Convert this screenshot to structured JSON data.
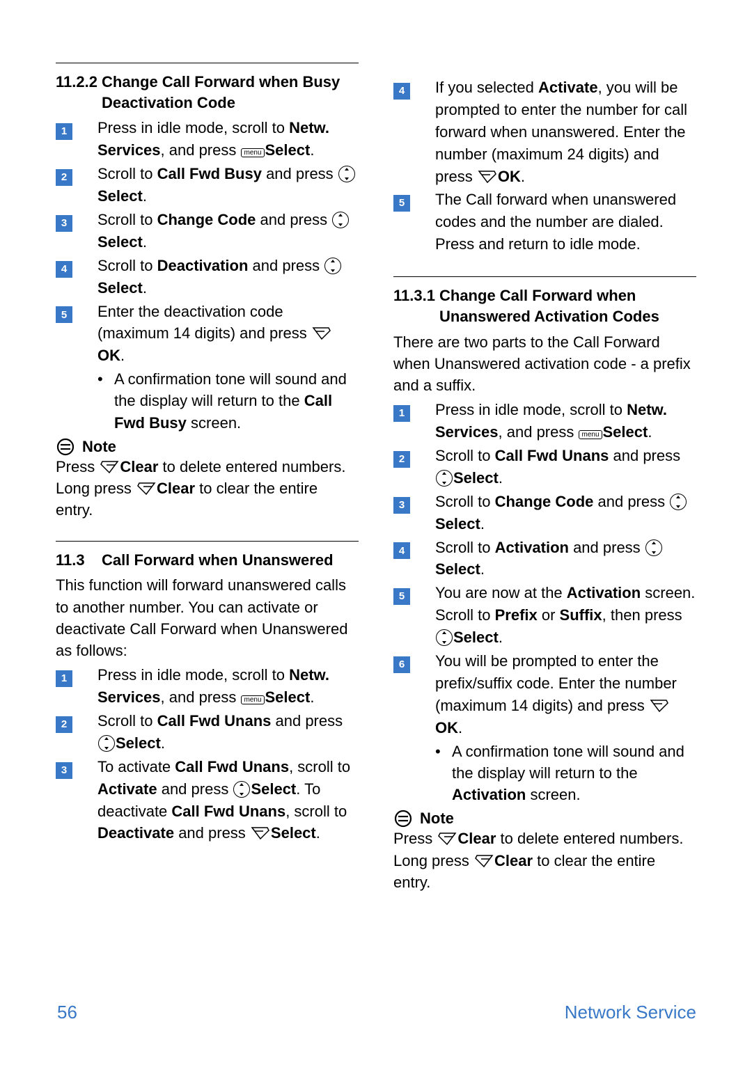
{
  "left": {
    "h1122_num": "11.2.2",
    "h1122_title": "Change Call Forward when Busy Deactivation Code",
    "steps_1122": [
      {
        "n": "1",
        "parts": [
          "Press ",
          " in idle mode, scroll ",
          " to ",
          {
            "b": "Netw. Services"
          },
          ", and press ",
          " ",
          {
            "b": "Select"
          },
          "."
        ]
      },
      {
        "n": "2",
        "parts": [
          "Scroll ",
          " to ",
          {
            "b": "Call Fwd Busy"
          },
          " and press ",
          " ",
          {
            "b": "Select"
          },
          "."
        ]
      },
      {
        "n": "3",
        "parts": [
          "Scroll ",
          " to ",
          {
            "b": "Change Code"
          },
          " and press ",
          " ",
          {
            "b": "Select"
          },
          "."
        ]
      },
      {
        "n": "4",
        "parts": [
          "Scroll ",
          " to ",
          {
            "b": "Deactivation"
          },
          " and press ",
          " ",
          {
            "b": "Select"
          },
          "."
        ]
      },
      {
        "n": "5",
        "parts": [
          "Enter the deactivation code (maximum 14 digits) and press ",
          " ",
          {
            "b": "OK"
          },
          "."
        ]
      }
    ],
    "sub_1122": [
      "A confirmation tone will sound and the display will return to the ",
      {
        "b": "Call Fwd Busy"
      },
      " screen."
    ],
    "note_label": "Note",
    "note_body_parts": [
      "Press ",
      " ",
      {
        "b": "Clear"
      },
      " to delete entered numbers. Long press ",
      " ",
      {
        "b": "Clear"
      },
      " to clear the entire entry."
    ],
    "h113_num": "11.3",
    "h113_title": "Call Forward when Unanswered",
    "p113": "This function will forward unanswered calls to another number. You can activate or deactivate Call Forward when Unanswered as follows:",
    "steps_113": [
      {
        "n": "1",
        "parts": [
          "Press ",
          " in idle mode, scroll ",
          " to ",
          {
            "b": "Netw. Services"
          },
          ", and press ",
          " ",
          {
            "b": "Select"
          },
          "."
        ]
      },
      {
        "n": "2",
        "parts": [
          "Scroll ",
          " to ",
          {
            "b": "Call Fwd Unans"
          },
          " and press ",
          " ",
          {
            "b": "Select"
          },
          "."
        ]
      },
      {
        "n": "3",
        "parts": [
          "To activate ",
          {
            "b": "Call Fwd Unans"
          },
          ", scroll ",
          " to ",
          {
            "b": "Activate"
          },
          " and press ",
          " ",
          {
            "b": "Select"
          },
          ". To deactivate ",
          {
            "b": "Call Fwd Unans"
          },
          ", scroll to ",
          {
            "b": "Deactivate"
          },
          " and press ",
          " ",
          {
            "b": "Select"
          },
          "."
        ]
      }
    ]
  },
  "right": {
    "steps_113_cont": [
      {
        "n": "4",
        "parts": [
          "If you selected ",
          {
            "b": "Activate"
          },
          ", you will be prompted to enter the number for call forward when unanswered. Enter the number (maximum 24 digits) and press ",
          " ",
          {
            "b": "OK"
          },
          "."
        ]
      },
      {
        "n": "5",
        "parts": [
          "The Call forward when unanswered codes and the number are dialed. Press ",
          " and return to idle mode."
        ]
      }
    ],
    "h1131_num": "11.3.1",
    "h1131_title": "Change Call Forward when Unanswered Activation Codes",
    "p1131": "There are two parts to the Call Forward when Unanswered activation code - a prefix and a suffix.",
    "steps_1131": [
      {
        "n": "1",
        "parts": [
          "Press ",
          " in idle mode, scroll ",
          " to ",
          {
            "b": "Netw. Services"
          },
          ", and press ",
          " ",
          {
            "b": "Select"
          },
          "."
        ]
      },
      {
        "n": "2",
        "parts": [
          "Scroll ",
          " to ",
          {
            "b": "Call Fwd Unans"
          },
          " and press ",
          " ",
          {
            "b": "Select"
          },
          "."
        ]
      },
      {
        "n": "3",
        "parts": [
          "Scroll ",
          " to ",
          {
            "b": "Change Code"
          },
          " and press ",
          " ",
          {
            "b": "Select"
          },
          "."
        ]
      },
      {
        "n": "4",
        "parts": [
          "Scroll ",
          " to ",
          {
            "b": "Activation"
          },
          " and press ",
          " ",
          {
            "b": "Select"
          },
          "."
        ]
      },
      {
        "n": "5",
        "parts": [
          "You are now at the ",
          {
            "b": "Activation"
          },
          " screen. Scroll ",
          " to ",
          {
            "b": "Prefix"
          },
          " or ",
          {
            "b": "Suffix"
          },
          ", then press ",
          " ",
          {
            "b": "Select"
          },
          "."
        ]
      },
      {
        "n": "6",
        "parts": [
          "You will be prompted to enter the prefix/suffix code. Enter the number (maximum 14 digits) and press ",
          " ",
          {
            "b": "OK"
          },
          "."
        ]
      }
    ],
    "sub_1131": [
      "A confirmation tone will sound and the display will return to the ",
      {
        "b": "Activation"
      },
      " screen."
    ],
    "note_label": "Note",
    "note_body_parts": [
      "Press ",
      " ",
      {
        "b": "Clear"
      },
      " to delete entered numbers. Long press ",
      " ",
      {
        "b": "Clear"
      },
      " to clear the entire entry."
    ]
  },
  "footer": {
    "page": "56",
    "section": "Network Service"
  },
  "icons": {
    "menu_text": "menu"
  }
}
